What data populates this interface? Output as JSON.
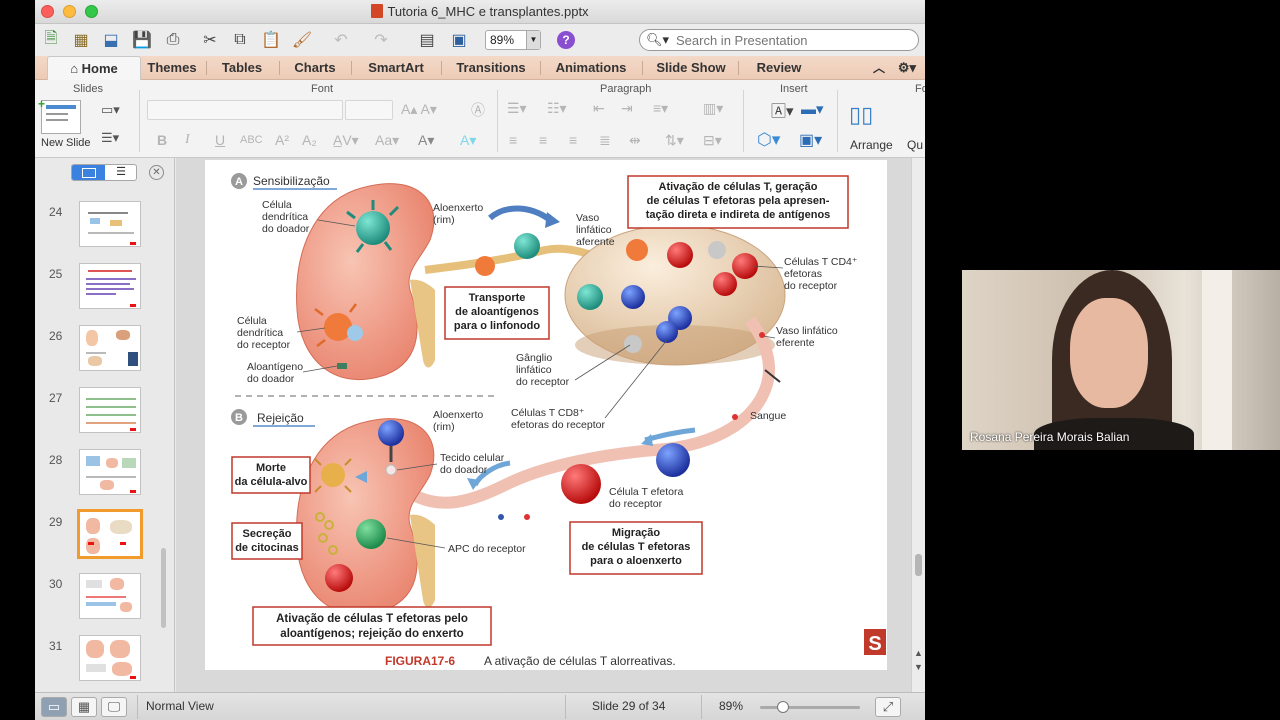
{
  "window": {
    "title": "Tutoria 6_MHC e transplantes.pptx"
  },
  "toolbar": {
    "zoom": "89%",
    "help_label": "?",
    "search_placeholder": "Search in Presentation"
  },
  "tabs": [
    "Home",
    "Themes",
    "Tables",
    "Charts",
    "SmartArt",
    "Transitions",
    "Animations",
    "Slide Show",
    "Review"
  ],
  "ribbon": {
    "groups": {
      "slides": "Slides",
      "font": "Font",
      "paragraph": "Paragraph",
      "insert": "Insert",
      "format_partial": "Fo"
    },
    "new_slide": "New Slide",
    "arrange": "Arrange",
    "quick_partial": "Qu"
  },
  "thumbnails": [
    {
      "num": "24"
    },
    {
      "num": "25"
    },
    {
      "num": "26"
    },
    {
      "num": "27"
    },
    {
      "num": "28"
    },
    {
      "num": "29",
      "selected": true
    },
    {
      "num": "30"
    },
    {
      "num": "31"
    }
  ],
  "slide": {
    "section_a": "A",
    "section_a_title": "Sensibilização",
    "section_b": "B",
    "section_b_title": "Rejeição",
    "labels": {
      "cel_dend_doador": [
        "Célula",
        "dendrítica",
        "do doador"
      ],
      "aloenxerto_a": [
        "Aloenxerto",
        "(rim)"
      ],
      "vaso_aferente": [
        "Vaso",
        "linfático",
        "aferente"
      ],
      "ativacao_box": [
        "Ativação de células T, geração",
        "de células T efetoras pela apresen-",
        "tação direta e indireta de antígenos"
      ],
      "cd4": [
        "Células T CD4⁺",
        "efetoras",
        "do receptor"
      ],
      "transporte_box": [
        "Transporte",
        "de aloantígenos",
        "para o linfonodo"
      ],
      "cel_dend_receptor": [
        "Célula",
        "dendrítica",
        "do receptor"
      ],
      "aloantigeno": [
        "Aloantígeno",
        "do doador"
      ],
      "ganglio": [
        "Gânglio",
        "linfático",
        "do receptor"
      ],
      "vaso_eferente": [
        "Vaso linfático",
        "eferente"
      ],
      "cd8": [
        "Células T CD8⁺",
        "efetoras do receptor"
      ],
      "sangue": "Sangue",
      "aloenxerto_b": [
        "Aloenxerto",
        "(rim)"
      ],
      "tecido": [
        "Tecido celular",
        "do doador"
      ],
      "morte_box": [
        "Morte",
        "da célula-alvo"
      ],
      "secrecao_box": [
        "Secreção",
        "de citocinas"
      ],
      "apc": "APC do receptor",
      "celula_t_efetora": [
        "Célula T efetora",
        "do receptor"
      ],
      "migracao_box": [
        "Migração",
        "de células T efetoras",
        "para o aloenxerto"
      ],
      "ativacao_b_box": [
        "Ativação de células T efetoras pelo",
        "aloantígenos; rejeição do enxerto"
      ]
    },
    "figure_label": "FIGURA17-6",
    "figure_caption": "A ativação de células T alorreativas.",
    "logo_letter": "S"
  },
  "statusbar": {
    "view": "Normal View",
    "slide_count": "Slide 29 of 34",
    "zoom": "89%"
  },
  "webcam": {
    "name": "Rosana Pereira Morais Balian"
  },
  "colors": {
    "tab_bar": "#eccbb6",
    "selection": "#f09b2c",
    "box_border": "#c0392b",
    "figure_label": "#c0392b",
    "kidney": "#f0a08a",
    "help": "#8a4fd0"
  }
}
